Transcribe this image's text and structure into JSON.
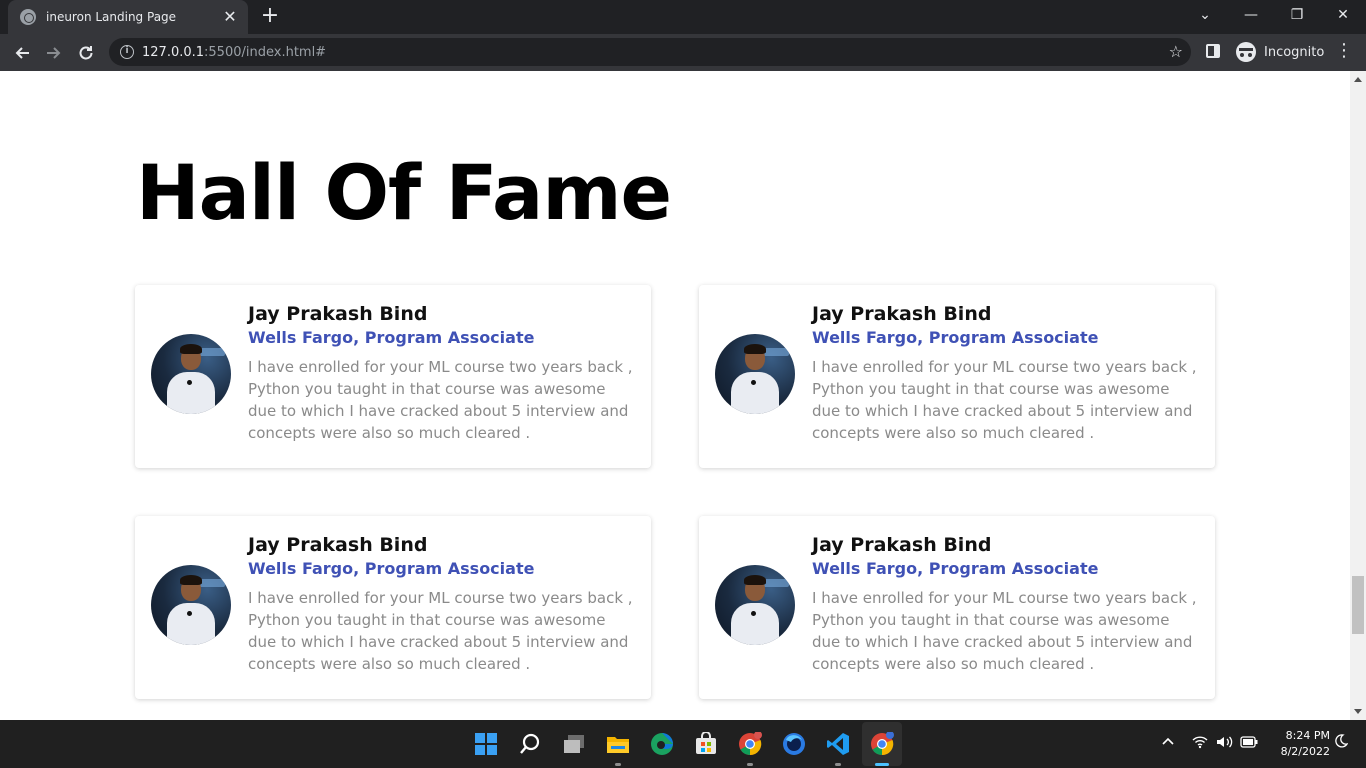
{
  "browser": {
    "tab_title": "ineuron Landing Page",
    "tab_close": "✕",
    "new_tab": "+",
    "url_host": "127.0.0.1",
    "url_path": ":5500/index.html#",
    "profile_label": "Incognito",
    "window_controls": {
      "minimize": "—",
      "restore": "❐",
      "close": "✕",
      "tab_search": "⌄"
    }
  },
  "page": {
    "heading": "Hall Of Fame",
    "testimonials": [
      {
        "name": "Jay Prakash Bind",
        "role": "Wells Fargo, Program Associate",
        "text": "I have enrolled for your ML course two years back , Python you taught in that course was awesome due to which I have cracked about 5 interview and concepts were also so much cleared ."
      },
      {
        "name": "Jay Prakash Bind",
        "role": "Wells Fargo, Program Associate",
        "text": "I have enrolled for your ML course two years back , Python you taught in that course was awesome due to which I have cracked about 5 interview and concepts were also so much cleared ."
      },
      {
        "name": "Jay Prakash Bind",
        "role": "Wells Fargo, Program Associate",
        "text": "I have enrolled for your ML course two years back , Python you taught in that course was awesome due to which I have cracked about 5 interview and concepts were also so much cleared ."
      },
      {
        "name": "Jay Prakash Bind",
        "role": "Wells Fargo, Program Associate",
        "text": "I have enrolled for your ML course two years back , Python you taught in that course was awesome due to which I have cracked about 5 interview and concepts were also so much cleared ."
      }
    ]
  },
  "taskbar": {
    "time": "8:24 PM",
    "date": "8/2/2022",
    "apps": [
      "start-icon",
      "search-icon",
      "task-view-icon",
      "file-explorer-icon",
      "edge-icon",
      "store-icon",
      "chrome-icon",
      "firefox-icon",
      "vscode-icon",
      "chrome-active-icon"
    ]
  },
  "colors": {
    "role_accent": "#3f51b5",
    "chrome_dark": "#202124",
    "chrome_toolbar": "#35363a",
    "taskbar": "#202020"
  }
}
